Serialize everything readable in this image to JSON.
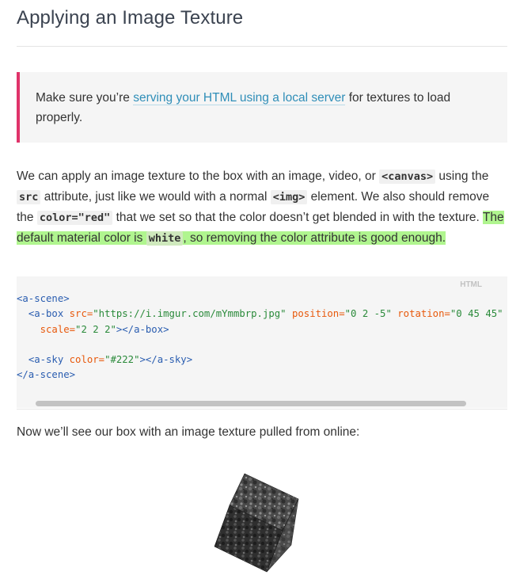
{
  "heading": "Applying an Image Texture",
  "note": {
    "before": "Make sure you’re ",
    "link": "serving your HTML using a local server",
    "after": " for textures to load properly."
  },
  "paragraph": {
    "p1": "We can apply an image texture to the box with an image, video, or ",
    "c1": "<canvas>",
    "p2": " using the ",
    "c2": "src",
    "p3": " attribute, just like we would with a normal ",
    "c3": "<img>",
    "p4": " element. We also should remove the ",
    "c4": "color=\"red\"",
    "p5": " that we set so that the color doesn’t get blended in with the texture. ",
    "h1": "The default material color is ",
    "hc": "white",
    "h2": ", so removing the color attribute is good enough."
  },
  "code": {
    "language": "HTML",
    "open_scene": "<a-scene>",
    "box_open": "<a-box",
    "src_attr": "src=",
    "src_val": "\"https://i.imgur.com/mYmmbrp.jpg\"",
    "pos_attr": "position=",
    "pos_val": "\"0 2 -5\"",
    "rot_attr": "rotation=",
    "rot_val": "\"0 45 45\"",
    "scale_attr": "scale=",
    "scale_val": "\"2 2 2\"",
    "box_close": "></a-box>",
    "sky_open": "<a-sky",
    "color_attr": "color=",
    "color_val": "\"#222\"",
    "sky_close": "></a-sky>",
    "close_scene": "</a-scene>"
  },
  "after_code": "Now we’ll see our box with an image texture pulled from online:",
  "colors": {
    "accent_border": "#e0336a",
    "link": "#2f8eb8",
    "highlight": "#b0f58f"
  }
}
